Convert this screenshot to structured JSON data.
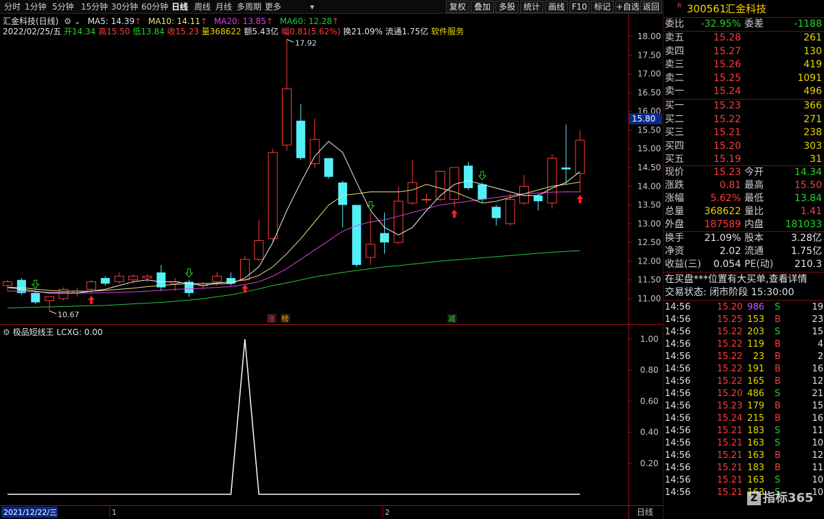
{
  "toolbar": {
    "timeframes": [
      "分时",
      "1分钟",
      "5分钟",
      "15分钟",
      "30分钟",
      "60分钟",
      "日线",
      "周线",
      "月线",
      "多周期",
      "更多"
    ],
    "active_timeframe": "日线",
    "buttons": [
      "复权",
      "叠加",
      "多股",
      "统计",
      "画线",
      "F10",
      "标记",
      "+自选",
      "返回"
    ]
  },
  "main_chart": {
    "title": "汇金科技(日线)",
    "ma5": "MA5: 14.39",
    "ma10": "MA10: 14.11",
    "ma20": "MA20: 13.85",
    "ma60": "MA60: 12.28",
    "date": "2022/02/25/五",
    "open": "开14.34",
    "high": "高15.50",
    "low": "低13.84",
    "close": "收15.23",
    "volume": "量368622",
    "amount": "额5.43亿",
    "change": "幅0.81(5.62%)",
    "turnover": "换21.09%",
    "float_cap": "流通1.75亿",
    "industry": "软件服务",
    "high_marker": "17.92",
    "low_marker": "10.67",
    "current_price_tag": "15.80",
    "event_labels": [
      "涨",
      "榜",
      "减"
    ]
  },
  "sub_chart": {
    "title": "极品短线王",
    "indicator": "LCXG: 0.00"
  },
  "bottom_bar": {
    "date_label": "2021/12/22/三",
    "month_marks": [
      "1",
      "2"
    ],
    "period_label": "日线"
  },
  "chart_data": {
    "type": "candlestick",
    "y_ticks": [
      18.0,
      17.5,
      17.0,
      16.5,
      16.0,
      15.5,
      15.0,
      14.5,
      14.0,
      13.5,
      13.0,
      12.5,
      12.0,
      11.5,
      11.0
    ],
    "ylim": [
      10.5,
      18.5
    ],
    "candles": [
      {
        "o": 11.35,
        "h": 11.5,
        "l": 11.2,
        "c": 11.45
      },
      {
        "o": 11.5,
        "h": 11.55,
        "l": 11.1,
        "c": 11.15
      },
      {
        "o": 11.15,
        "h": 11.2,
        "l": 10.85,
        "c": 10.9
      },
      {
        "o": 10.95,
        "h": 11.05,
        "l": 10.67,
        "c": 11.05
      },
      {
        "o": 11.0,
        "h": 11.3,
        "l": 10.95,
        "c": 11.25
      },
      {
        "o": 11.15,
        "h": 11.3,
        "l": 11.05,
        "c": 11.2
      },
      {
        "o": 11.25,
        "h": 11.5,
        "l": 11.15,
        "c": 11.45
      },
      {
        "o": 11.55,
        "h": 11.6,
        "l": 11.35,
        "c": 11.4
      },
      {
        "o": 11.45,
        "h": 11.7,
        "l": 11.4,
        "c": 11.6
      },
      {
        "o": 11.5,
        "h": 11.65,
        "l": 11.4,
        "c": 11.6
      },
      {
        "o": 11.55,
        "h": 11.65,
        "l": 11.45,
        "c": 11.6
      },
      {
        "o": 11.7,
        "h": 11.9,
        "l": 11.2,
        "c": 11.3
      },
      {
        "o": 11.4,
        "h": 11.55,
        "l": 11.2,
        "c": 11.45
      },
      {
        "o": 11.45,
        "h": 11.5,
        "l": 11.05,
        "c": 11.15
      },
      {
        "o": 11.35,
        "h": 11.45,
        "l": 11.25,
        "c": 11.4
      },
      {
        "o": 11.45,
        "h": 11.7,
        "l": 11.35,
        "c": 11.6
      },
      {
        "o": 11.55,
        "h": 11.7,
        "l": 11.35,
        "c": 11.4
      },
      {
        "o": 11.5,
        "h": 12.15,
        "l": 11.45,
        "c": 12.05
      },
      {
        "o": 12.05,
        "h": 13.1,
        "l": 12.0,
        "c": 12.55
      },
      {
        "o": 12.6,
        "h": 15.0,
        "l": 12.5,
        "c": 14.9
      },
      {
        "o": 15.1,
        "h": 17.92,
        "l": 14.95,
        "c": 16.6
      },
      {
        "o": 15.75,
        "h": 16.2,
        "l": 14.7,
        "c": 14.75
      },
      {
        "o": 14.6,
        "h": 15.8,
        "l": 14.5,
        "c": 15.25
      },
      {
        "o": 14.75,
        "h": 14.75,
        "l": 14.2,
        "c": 14.25
      },
      {
        "o": 14.1,
        "h": 14.15,
        "l": 12.9,
        "c": 13.5
      },
      {
        "o": 13.5,
        "h": 13.5,
        "l": 11.85,
        "c": 11.9
      },
      {
        "o": 12.1,
        "h": 13.3,
        "l": 11.9,
        "c": 12.45
      },
      {
        "o": 12.75,
        "h": 13.3,
        "l": 12.2,
        "c": 12.5
      },
      {
        "o": 12.5,
        "h": 14.0,
        "l": 12.45,
        "c": 13.6
      },
      {
        "o": 13.55,
        "h": 14.7,
        "l": 13.5,
        "c": 14.1
      },
      {
        "o": 13.65,
        "h": 13.8,
        "l": 13.55,
        "c": 13.65
      },
      {
        "o": 13.65,
        "h": 14.4,
        "l": 13.6,
        "c": 14.4
      },
      {
        "o": 13.65,
        "h": 14.2,
        "l": 13.45,
        "c": 14.5
      },
      {
        "o": 14.55,
        "h": 14.65,
        "l": 13.9,
        "c": 13.95
      },
      {
        "o": 14.05,
        "h": 14.1,
        "l": 13.55,
        "c": 13.65
      },
      {
        "o": 13.45,
        "h": 13.5,
        "l": 12.95,
        "c": 13.15
      },
      {
        "o": 13.0,
        "h": 13.8,
        "l": 12.95,
        "c": 13.65
      },
      {
        "o": 13.55,
        "h": 14.3,
        "l": 13.5,
        "c": 14.0
      },
      {
        "o": 13.75,
        "h": 13.8,
        "l": 13.35,
        "c": 13.6
      },
      {
        "o": 13.55,
        "h": 14.85,
        "l": 13.4,
        "c": 14.75
      },
      {
        "o": 14.5,
        "h": 15.65,
        "l": 14.05,
        "c": 14.45
      },
      {
        "o": 14.34,
        "h": 15.5,
        "l": 13.84,
        "c": 15.23
      }
    ],
    "ma5": [
      11.3,
      11.25,
      11.2,
      11.15,
      11.15,
      11.15,
      11.2,
      11.25,
      11.35,
      11.45,
      11.5,
      11.45,
      11.45,
      11.4,
      11.35,
      11.4,
      11.4,
      11.55,
      11.85,
      12.5,
      13.35,
      14.1,
      14.8,
      15.2,
      14.9,
      14.1,
      13.35,
      12.9,
      12.7,
      12.9,
      13.35,
      13.75,
      14.05,
      14.15,
      14.05,
      13.95,
      13.85,
      13.75,
      13.75,
      13.95,
      14.1,
      14.39
    ],
    "ma10": [
      11.3,
      11.3,
      11.25,
      11.22,
      11.2,
      11.2,
      11.2,
      11.22,
      11.25,
      11.28,
      11.32,
      11.35,
      11.38,
      11.4,
      11.4,
      11.42,
      11.45,
      11.5,
      11.62,
      11.85,
      12.2,
      12.6,
      13.05,
      13.5,
      13.75,
      13.8,
      13.85,
      13.85,
      13.85,
      13.9,
      14.05,
      13.95,
      13.85,
      13.7,
      13.55,
      13.6,
      13.7,
      13.8,
      13.9,
      14.0,
      14.05,
      14.11
    ],
    "ma20": [
      11.2,
      11.2,
      11.18,
      11.17,
      11.16,
      11.15,
      11.15,
      11.16,
      11.17,
      11.18,
      11.2,
      11.22,
      11.25,
      11.26,
      11.28,
      11.3,
      11.32,
      11.38,
      11.45,
      11.6,
      11.8,
      12.05,
      12.3,
      12.55,
      12.8,
      12.95,
      13.05,
      13.1,
      13.2,
      13.3,
      13.4,
      13.5,
      13.55,
      13.6,
      13.65,
      13.7,
      13.75,
      13.8,
      13.82,
      13.84,
      13.85,
      13.85
    ],
    "ma60": [
      10.75,
      10.76,
      10.77,
      10.78,
      10.79,
      10.8,
      10.81,
      10.82,
      10.84,
      10.86,
      10.88,
      10.9,
      10.93,
      10.96,
      11.0,
      11.05,
      11.1,
      11.18,
      11.26,
      11.35,
      11.42,
      11.5,
      11.58,
      11.64,
      11.7,
      11.75,
      11.8,
      11.85,
      11.88,
      11.92,
      11.96,
      12.0,
      12.03,
      12.06,
      12.09,
      12.12,
      12.15,
      12.18,
      12.21,
      12.24,
      12.26,
      12.28
    ],
    "lcxg_ticks": [
      1.0,
      0.8,
      0.6,
      0.4,
      0.2
    ],
    "lcxg_ylim": [
      0,
      1.1
    ],
    "lcxg_spike_index": 17,
    "lcxg_spike_value": 1.0,
    "buy_signal_indices": [
      6,
      17,
      32,
      41
    ],
    "sell_signal_indices": [
      2,
      13,
      26,
      34
    ]
  },
  "quote_panel": {
    "code": "300561",
    "name": "汇金科技",
    "badge": "R",
    "webi_label": "委比",
    "webi_value": "-32.95%",
    "weicha_label": "委差",
    "weicha_value": "-1188",
    "asks": [
      {
        "label": "卖五",
        "price": "15.28",
        "vol": "261"
      },
      {
        "label": "卖四",
        "price": "15.27",
        "vol": "130"
      },
      {
        "label": "卖三",
        "price": "15.26",
        "vol": "419"
      },
      {
        "label": "卖二",
        "price": "15.25",
        "vol": "1091"
      },
      {
        "label": "卖一",
        "price": "15.24",
        "vol": "496"
      }
    ],
    "bids": [
      {
        "label": "买一",
        "price": "15.23",
        "vol": "366"
      },
      {
        "label": "买二",
        "price": "15.22",
        "vol": "271"
      },
      {
        "label": "买三",
        "price": "15.21",
        "vol": "238"
      },
      {
        "label": "买四",
        "price": "15.20",
        "vol": "303"
      },
      {
        "label": "买五",
        "price": "15.19",
        "vol": "31"
      }
    ],
    "stats": [
      {
        "l1": "现价",
        "v1": "15.23",
        "c1": "red",
        "l2": "今开",
        "v2": "14.34",
        "c2": "green"
      },
      {
        "l1": "涨跌",
        "v1": "0.81",
        "c1": "red",
        "l2": "最高",
        "v2": "15.50",
        "c2": "red"
      },
      {
        "l1": "涨幅",
        "v1": "5.62%",
        "c1": "red",
        "l2": "最低",
        "v2": "13.84",
        "c2": "green"
      },
      {
        "l1": "总量",
        "v1": "368622",
        "c1": "yellow",
        "l2": "量比",
        "v2": "1.41",
        "c2": "red"
      },
      {
        "l1": "外盘",
        "v1": "187589",
        "c1": "red",
        "l2": "内盘",
        "v2": "181033",
        "c2": "green"
      }
    ],
    "stats2": [
      {
        "l1": "换手",
        "v1": "21.09%",
        "l2": "股本",
        "v2": "3.28亿"
      },
      {
        "l1": "净资",
        "v1": "2.02",
        "l2": "流通",
        "v2": "1.75亿"
      },
      {
        "l1": "收益(三)",
        "v1": "0.054",
        "l2": "PE(动)",
        "v2": "210.3"
      }
    ],
    "notice": "在买盘***位置有大买单,查看详情",
    "trade_status": "交易状态: 闭市阶段 15:30:00",
    "ticks": [
      {
        "time": "14:56",
        "price": "15.20",
        "vol": "986",
        "side": "S",
        "n": "19"
      },
      {
        "time": "14:56",
        "price": "15.25",
        "vol": "153",
        "side": "B",
        "n": "23"
      },
      {
        "time": "14:56",
        "price": "15.22",
        "vol": "203",
        "side": "S",
        "n": "15"
      },
      {
        "time": "14:56",
        "price": "15.22",
        "vol": "119",
        "side": "B",
        "n": "4"
      },
      {
        "time": "14:56",
        "price": "15.22",
        "vol": "23",
        "side": "B",
        "n": "2"
      },
      {
        "time": "14:56",
        "price": "15.22",
        "vol": "191",
        "side": "B",
        "n": "16"
      },
      {
        "time": "14:56",
        "price": "15.22",
        "vol": "165",
        "side": "B",
        "n": "12"
      },
      {
        "time": "14:56",
        "price": "15.20",
        "vol": "486",
        "side": "S",
        "n": "21"
      },
      {
        "time": "14:56",
        "price": "15.23",
        "vol": "179",
        "side": "B",
        "n": "15"
      },
      {
        "time": "14:56",
        "price": "15.24",
        "vol": "215",
        "side": "B",
        "n": "16"
      },
      {
        "time": "14:56",
        "price": "15.21",
        "vol": "183",
        "side": "S",
        "n": "11"
      },
      {
        "time": "14:56",
        "price": "15.21",
        "vol": "163",
        "side": "S",
        "n": "10"
      },
      {
        "time": "14:56",
        "price": "15.21",
        "vol": "163",
        "side": "B",
        "n": "12"
      },
      {
        "time": "14:56",
        "price": "15.21",
        "vol": "183",
        "side": "B",
        "n": "11"
      },
      {
        "time": "14:56",
        "price": "15.21",
        "vol": "163",
        "side": "S",
        "n": "10"
      },
      {
        "time": "14:56",
        "price": "15.21",
        "vol": "163",
        "side": "S",
        "n": "10"
      }
    ],
    "watermark": "指标365"
  },
  "colors": {
    "up": "#ff3c3c",
    "down": "#54f0f8",
    "ma5": "#f2f2f2",
    "ma10": "#e8e27a",
    "ma20": "#e040e0",
    "ma60": "#27c83c",
    "axis": "#a01010"
  }
}
